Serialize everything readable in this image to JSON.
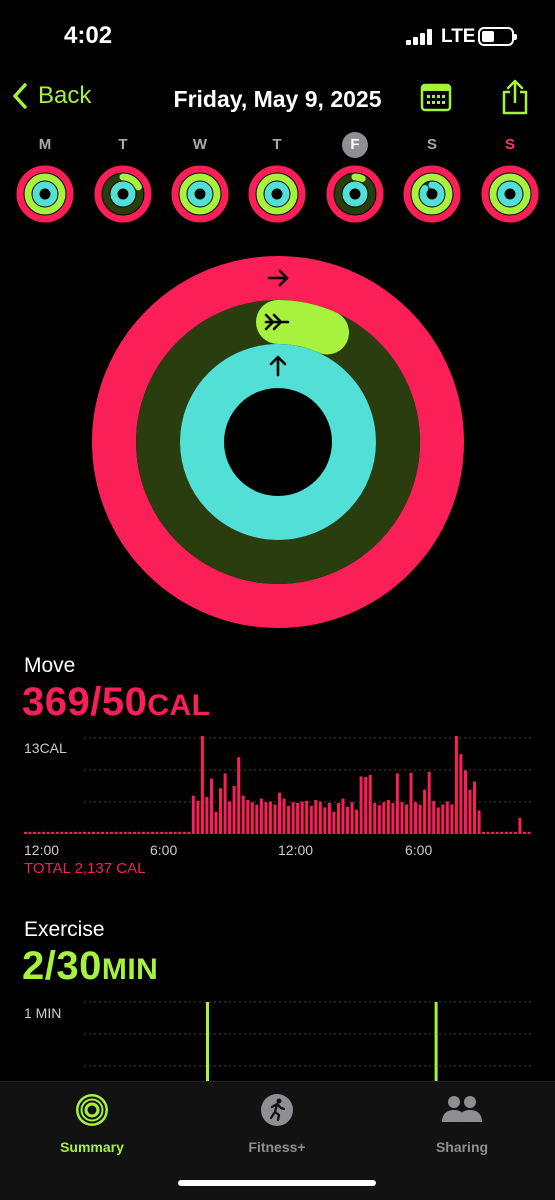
{
  "status_bar": {
    "time": "4:02",
    "network": "LTE"
  },
  "nav": {
    "back_label": "Back",
    "title": "Friday, May 9, 2025",
    "calendar_icon": "calendar-icon",
    "share_icon": "share-icon"
  },
  "week": {
    "days": [
      {
        "label": "M",
        "move": 1.0,
        "exercise": 1.0,
        "stand": 1.0
      },
      {
        "label": "T",
        "move": 1.0,
        "exercise": 0.18,
        "stand": 1.0
      },
      {
        "label": "W",
        "move": 1.0,
        "exercise": 1.0,
        "stand": 1.0
      },
      {
        "label": "T",
        "move": 1.0,
        "exercise": 1.0,
        "stand": 1.0
      },
      {
        "label": "F",
        "move": 1.0,
        "exercise": 0.07,
        "stand": 1.0,
        "selected": true
      },
      {
        "label": "S",
        "move": 1.0,
        "exercise": 1.0,
        "stand": 0.85
      },
      {
        "label": "S",
        "move": 1.0,
        "exercise": 1.0,
        "stand": 1.0
      }
    ]
  },
  "rings": {
    "move_progress": 7.38,
    "exercise_progress": 0.067,
    "stand_progress": 1.4
  },
  "colors": {
    "move": "#fa1f57",
    "exercise": "#a6f23c",
    "stand": "#52e0d6",
    "accent": "#a6f23c"
  },
  "move": {
    "label": "Move",
    "value": "369/50",
    "unit": "CAL",
    "chart_max_label": "13CAL",
    "x_labels": [
      "12:00",
      "6:00",
      "12:00",
      "6:00"
    ],
    "total": "TOTAL 2,137 CAL"
  },
  "exercise": {
    "label": "Exercise",
    "value": "2/30",
    "unit": "MIN",
    "chart_max_label": "1 MIN"
  },
  "chart_data": [
    {
      "type": "bar",
      "title": "Move",
      "ylabel": "CAL",
      "ylim": [
        0,
        13
      ],
      "x_ticks": [
        "12:00",
        "6:00",
        "12:00",
        "6:00"
      ],
      "values": [
        0.3,
        0.3,
        0.3,
        0.3,
        0.3,
        0.3,
        0.3,
        0.3,
        0.3,
        0.3,
        0.3,
        0.3,
        0.3,
        0.3,
        0.3,
        0.3,
        0.3,
        0.3,
        0.3,
        0.3,
        0.3,
        0.3,
        0.3,
        0.3,
        0.3,
        0.3,
        0.3,
        0.3,
        0.3,
        0.3,
        0.3,
        0.3,
        0.3,
        0.3,
        0.3,
        0.3,
        0.3,
        5.2,
        4.5,
        13.5,
        5.0,
        7.5,
        3.0,
        6.2,
        8.2,
        4.4,
        6.5,
        10.4,
        5.2,
        4.6,
        4.3,
        4.0,
        4.8,
        4.3,
        4.4,
        4.0,
        5.6,
        4.8,
        3.8,
        4.3,
        4.2,
        4.4,
        4.5,
        3.8,
        4.6,
        4.4,
        3.6,
        4.2,
        3.0,
        4.2,
        4.8,
        3.7,
        4.3,
        3.3,
        7.8,
        7.7,
        8.0,
        4.2,
        3.9,
        4.3,
        4.6,
        4.2,
        8.2,
        4.3,
        4.0,
        8.3,
        4.3,
        4.0,
        6.0,
        8.4,
        4.5,
        3.6,
        4.0,
        4.4,
        4.0,
        13.4,
        10.8,
        8.6,
        6.0,
        7.1,
        3.2,
        0.3,
        0.3,
        0.3,
        0.3,
        0.3,
        0.3,
        0.3,
        0.3,
        2.2,
        0.3,
        0.3
      ]
    },
    {
      "type": "bar",
      "title": "Exercise",
      "ylabel": "MIN",
      "ylim": [
        0,
        1
      ],
      "bars": [
        {
          "hour": 8.6,
          "value": 1
        },
        {
          "hour": 19.4,
          "value": 1
        }
      ]
    }
  ],
  "tabbar": {
    "tabs": [
      {
        "label": "Summary",
        "icon": "activity-rings-icon",
        "active": true
      },
      {
        "label": "Fitness+",
        "icon": "runner-icon",
        "active": false
      },
      {
        "label": "Sharing",
        "icon": "people-icon",
        "active": false
      }
    ]
  }
}
